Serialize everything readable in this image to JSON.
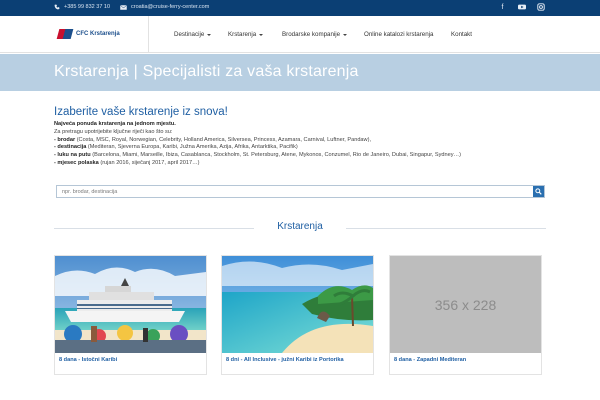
{
  "topbar": {
    "phone": "+385 99 832 37 10",
    "email": "croatia@cruise-ferry-center.com",
    "social": [
      "facebook-icon",
      "youtube-icon",
      "instagram-icon"
    ]
  },
  "brand": {
    "logo_text": "CFC Krstarenja"
  },
  "nav": {
    "items": [
      {
        "label": "Destinacije",
        "dropdown": true
      },
      {
        "label": "Krstarenja",
        "dropdown": true
      },
      {
        "label": "Brodarske kompanije",
        "dropdown": true
      },
      {
        "label": "Online katalozi krstarenja",
        "dropdown": false
      },
      {
        "label": "Kontakt",
        "dropdown": false
      }
    ]
  },
  "hero": {
    "title": "Krstarenja | Specijalisti za vaša krstarenja"
  },
  "intro": {
    "heading": "Izaberite vaše krstarenje iz snova!",
    "lead": "Najveća ponuda krstarenja na jednom mjestu.",
    "hint": "Za pretragu upotrijebite ključne riječi kao što su:",
    "lines": [
      {
        "key": "- brodar",
        "text": " (Costa, MSC, Royal, Norwegian, Celebrity, Holland America, Silversea, Princess, Azamara, Carnival, Luftner, Pandaw),"
      },
      {
        "key": "- destinacija",
        "text": " (Mediteran, Sjeverna Europa, Karibi, Južna Amerika, Azija, Afrika, Antarktika, Pacifik)"
      },
      {
        "key": "- luku na putu",
        "text": " (Barcelona, Miami, Marseille, Ibiza, Casablanca, Stockholm, St. Petersburg, Atene, Mykonos, Conzumel, Rio de Janeiro, Dubai, Singapur, Sydney…)"
      },
      {
        "key": "- mjesec polaska",
        "text": " (rujan 2016, siječanj 2017, april 2017…)"
      }
    ]
  },
  "search": {
    "placeholder": "npr. brodar, destinacija"
  },
  "section": {
    "title": "Krstarenja"
  },
  "cards": [
    {
      "caption": "8 dana - Istočni Karibi"
    },
    {
      "caption": "8 dni - All Inclusive - južni Karibi iz Portorika"
    },
    {
      "caption": "8 dana - Zapadni Mediteran",
      "placeholder": "356 x 228"
    }
  ],
  "colors": {
    "topbar": "#0b3f74",
    "hero": "#b8cfe2",
    "accent": "#1f5fa3"
  }
}
